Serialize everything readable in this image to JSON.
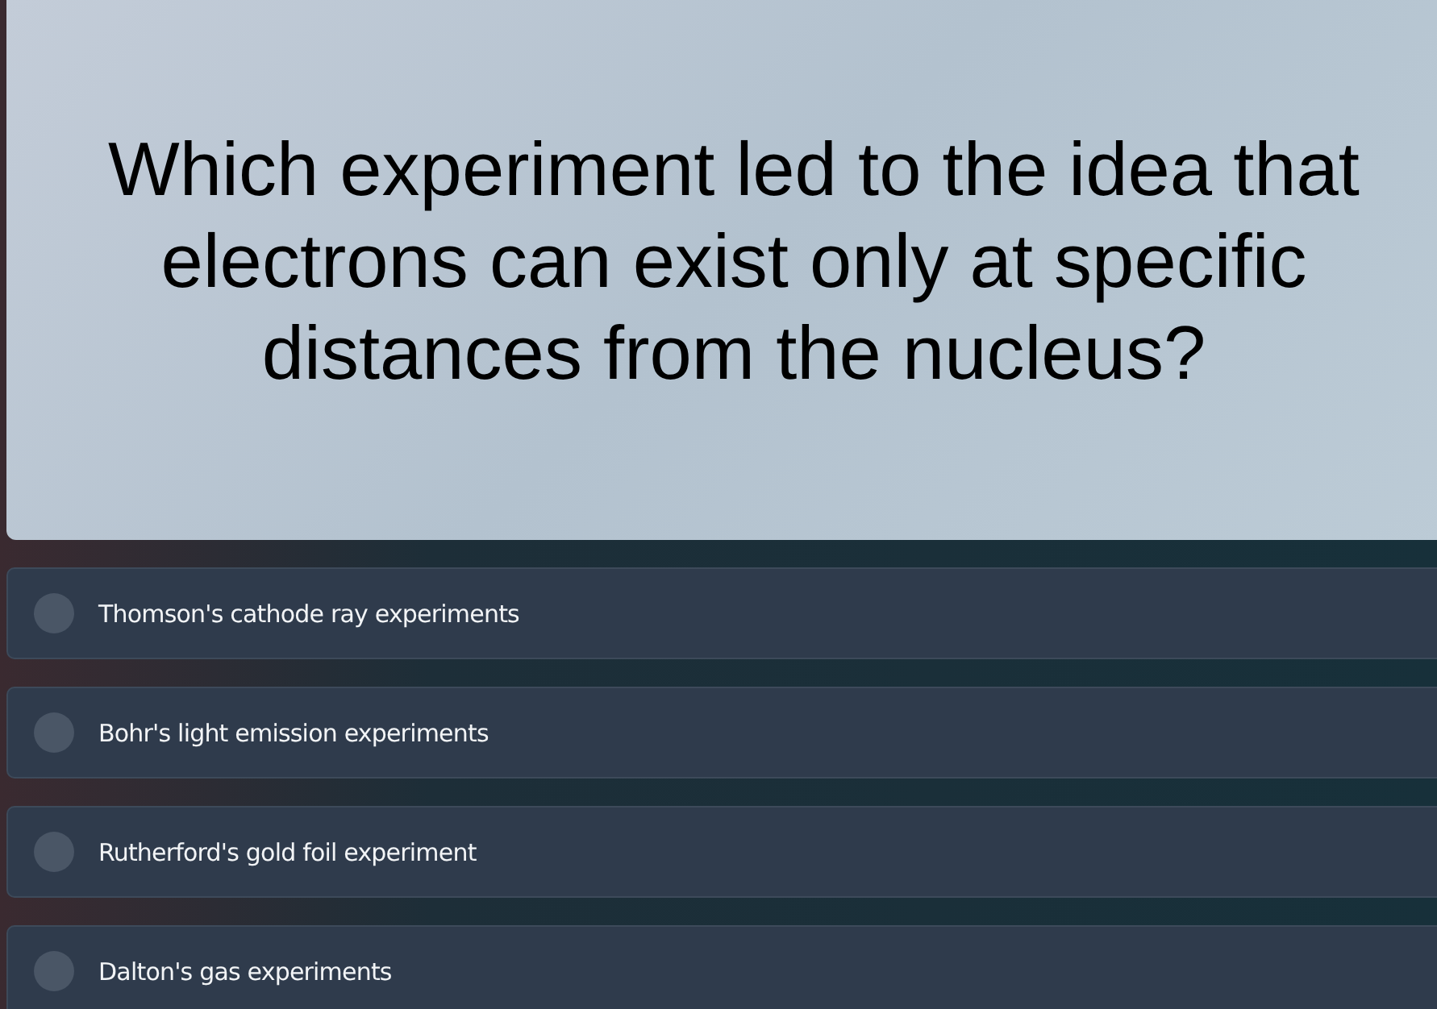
{
  "question": "Which experiment led to the idea that electrons can exist only at specific distances from the nucleus?",
  "options": [
    {
      "label": "Thomson's cathode ray experiments",
      "selected": false
    },
    {
      "label": "Bohr's light emission experiments",
      "selected": false
    },
    {
      "label": "Rutherford's gold foil experiment",
      "selected": false
    },
    {
      "label": "Dalton's gas experiments",
      "selected": false
    }
  ]
}
